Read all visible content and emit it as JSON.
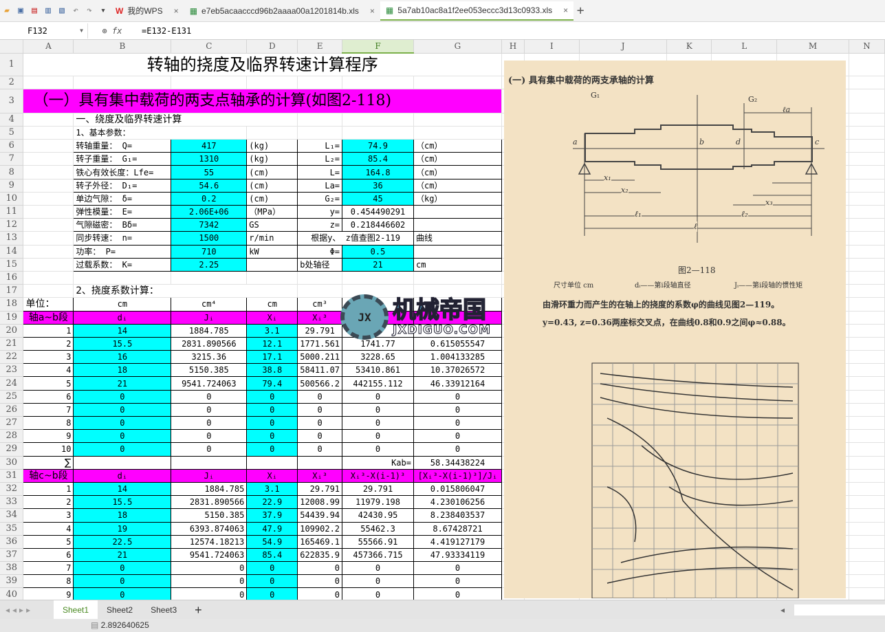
{
  "tabs": [
    {
      "label": "我的WPS"
    },
    {
      "label": "e7eb5acaacccd96b2aaaa00a1201814b.xls"
    },
    {
      "label": "5a7ab10ac8a1f2ee053eccc3d13c0933.xls",
      "active": true
    }
  ],
  "formula_bar": {
    "cell_ref": "F132",
    "fx": "fx",
    "formula": "=E132-E131"
  },
  "columns": [
    "A",
    "B",
    "C",
    "D",
    "E",
    "F",
    "G",
    "H",
    "I",
    "J",
    "K",
    "L",
    "M",
    "N"
  ],
  "selected_column": "F",
  "sheet": {
    "title": "转轴的挠度及临界转速计算程序",
    "section": "（一）具有集中载荷的两支点轴承的计算(如图2-118)",
    "sub1": "一、绕度及临界转速计算",
    "sub2": "1、基本参数：",
    "params": [
      [
        "转轴重量：    Q=",
        "417",
        "(kg)",
        "L₁=",
        "74.9",
        "（cm）"
      ],
      [
        "转子重量：    G₁=",
        "1310",
        "(kg)",
        "L₂=",
        "85.4",
        "（cm）"
      ],
      [
        "铁心有效长度：Lfe=",
        "55",
        "(cm)",
        "L=",
        "164.8",
        "（cm）"
      ],
      [
        "转子外径：    D₁=",
        "54.6",
        "(cm)",
        "La=",
        "36",
        "（cm）"
      ],
      [
        "单边气隙：    δ=",
        "0.2",
        "(cm)",
        "G₂=",
        "45",
        "（kg）"
      ],
      [
        "弹性模量：    E=",
        "2.06E+06",
        "（MPa）",
        "y=",
        "0.454490291",
        ""
      ],
      [
        "气隙磁密：    Bδ=",
        "7342",
        "GS",
        "z=",
        "0.218446602",
        ""
      ],
      [
        "同步转速：    n=",
        "1500",
        "r/min",
        "根据y、 z值查图2-119",
        "",
        "曲线"
      ],
      [
        "功率：        P=",
        "710",
        "kW",
        "Φ=",
        "0.5",
        ""
      ],
      [
        "过载系数：    K=",
        "2.25",
        "",
        "b处轴径",
        "21",
        "cm"
      ]
    ],
    "sub3": "2、挠度系数计算：",
    "units": [
      "单位：",
      "cm",
      "cm⁴",
      "cm",
      "cm³",
      "",
      ""
    ],
    "head_ab": [
      "轴a~b段",
      "dᵢ",
      "Jᵢ",
      "Xᵢ",
      "Xᵢ³",
      "",
      ""
    ],
    "rows_ab": [
      [
        "1",
        "14",
        "1884.785",
        "3.1",
        "29.791",
        "",
        ""
      ],
      [
        "2",
        "15.5",
        "2831.890566",
        "12.1",
        "1771.561",
        "1741.77",
        "0.615055547"
      ],
      [
        "3",
        "16",
        "3215.36",
        "17.1",
        "5000.211",
        "3228.65",
        "1.004133285"
      ],
      [
        "4",
        "18",
        "5150.385",
        "38.8",
        "58411.07",
        "53410.861",
        "10.37026572"
      ],
      [
        "5",
        "21",
        "9541.724063",
        "79.4",
        "500566.2",
        "442155.112",
        "46.33912164"
      ],
      [
        "6",
        "0",
        "0",
        "0",
        "0",
        "0",
        "0"
      ],
      [
        "7",
        "0",
        "0",
        "0",
        "0",
        "0",
        "0"
      ],
      [
        "8",
        "0",
        "0",
        "0",
        "0",
        "0",
        "0"
      ],
      [
        "9",
        "0",
        "0",
        "0",
        "0",
        "0",
        "0"
      ],
      [
        "10",
        "0",
        "0",
        "0",
        "0",
        "0",
        "0"
      ]
    ],
    "sum_row": [
      "∑",
      "",
      "",
      "",
      "",
      "Kab=",
      "58.34438224"
    ],
    "head_cb": [
      "轴c~b段",
      "dᵢ",
      "Jᵢ",
      "Xᵢ",
      "Xᵢ³",
      "Xᵢ³-X(i-1)³",
      "[Xᵢ³-X(i-1)³]/Jᵢ"
    ],
    "rows_cb": [
      [
        "1",
        "14",
        "1884.785",
        "3.1",
        "29.791",
        "29.791",
        "0.015806047"
      ],
      [
        "2",
        "15.5",
        "2831.890566",
        "22.9",
        "12008.99",
        "11979.198",
        "4.230106256"
      ],
      [
        "3",
        "18",
        "5150.385",
        "37.9",
        "54439.94",
        "42430.95",
        "8.238403537"
      ],
      [
        "4",
        "19",
        "6393.874063",
        "47.9",
        "109902.2",
        "55462.3",
        "8.67428721"
      ],
      [
        "5",
        "22.5",
        "12574.18213",
        "54.9",
        "165469.1",
        "55566.91",
        "4.419127179"
      ],
      [
        "6",
        "21",
        "9541.724063",
        "85.4",
        "622835.9",
        "457366.715",
        "47.93334119"
      ],
      [
        "7",
        "0",
        "0",
        "0",
        "0",
        "0",
        "0"
      ],
      [
        "8",
        "0",
        "0",
        "0",
        "0",
        "0",
        "0"
      ],
      [
        "9",
        "0",
        "0",
        "0",
        "0",
        "0",
        "0"
      ]
    ]
  },
  "picture": {
    "heading": "(一) 具有集中载荷的两支承轴的计算",
    "caption": "图2—118",
    "legend": [
      "尺寸单位  cm",
      "dᵢ——第i段轴直径",
      "Jᵢ——第i段轴的惯性矩"
    ],
    "text1": "由滑环重力而产生的在轴上的挠度的系数φ的曲线见图2—119。",
    "text2": "y=0.43, z=0.36两座标交叉点，在曲线0.8和0.9之间φ≈0.88。",
    "labels": [
      "G₁",
      "G₂",
      "ℓa",
      "a",
      "b",
      "d",
      "c",
      "x₁",
      "x₂",
      "ℓ₁",
      "ℓ₂",
      "ℓ",
      "x₃"
    ]
  },
  "watermark": {
    "big": "机械帝国",
    "small": "JXDIGUO.COM",
    "badge": "JX"
  },
  "sheet_tabs": [
    "Sheet1",
    "Sheet2",
    "Sheet3"
  ],
  "status": {
    "value": "2.892640625"
  }
}
